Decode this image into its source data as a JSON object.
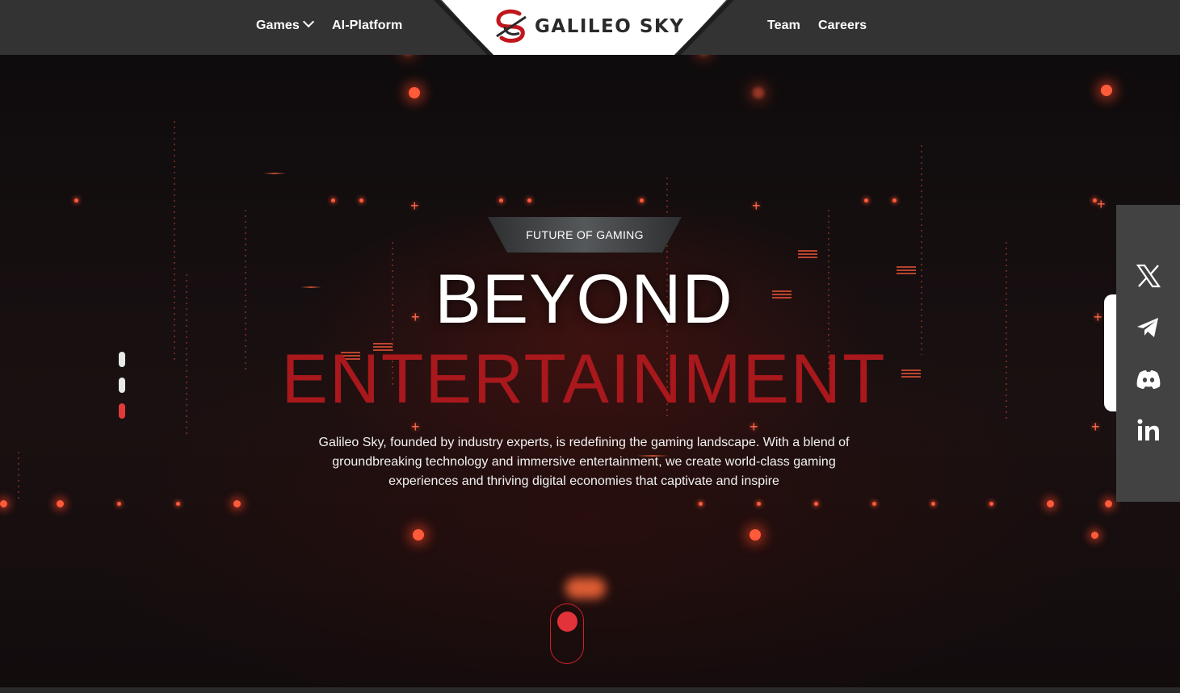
{
  "header": {
    "nav_left": [
      {
        "label": "Games",
        "has_dropdown": true,
        "icon": "chevron-down-icon"
      },
      {
        "label": "AI-Platform",
        "has_dropdown": false
      }
    ],
    "logo_text": "GALILEO SKY",
    "nav_right": [
      {
        "label": "Team"
      },
      {
        "label": "Careers"
      }
    ]
  },
  "hero": {
    "tagline": "FUTURE OF GAMING",
    "title_line1": "BEYOND",
    "title_line2": "ENTERTAINMENT",
    "description": "Galileo Sky, founded by industry experts, is redefining the gaming landscape. With a blend of groundbreaking technology and immersive entertainment, we create world-class gaming experiences and thriving digital economies that captivate and inspire"
  },
  "slider": {
    "count": 3,
    "active_index": 2
  },
  "social": [
    {
      "icon": "x-twitter-icon"
    },
    {
      "icon": "telegram-icon"
    },
    {
      "icon": "discord-icon"
    },
    {
      "icon": "linkedin-icon"
    }
  ],
  "colors": {
    "accent_red": "#a8181c",
    "active_red": "#e23a3a",
    "topbar": "#333334",
    "particle": "#ff5a3a"
  }
}
